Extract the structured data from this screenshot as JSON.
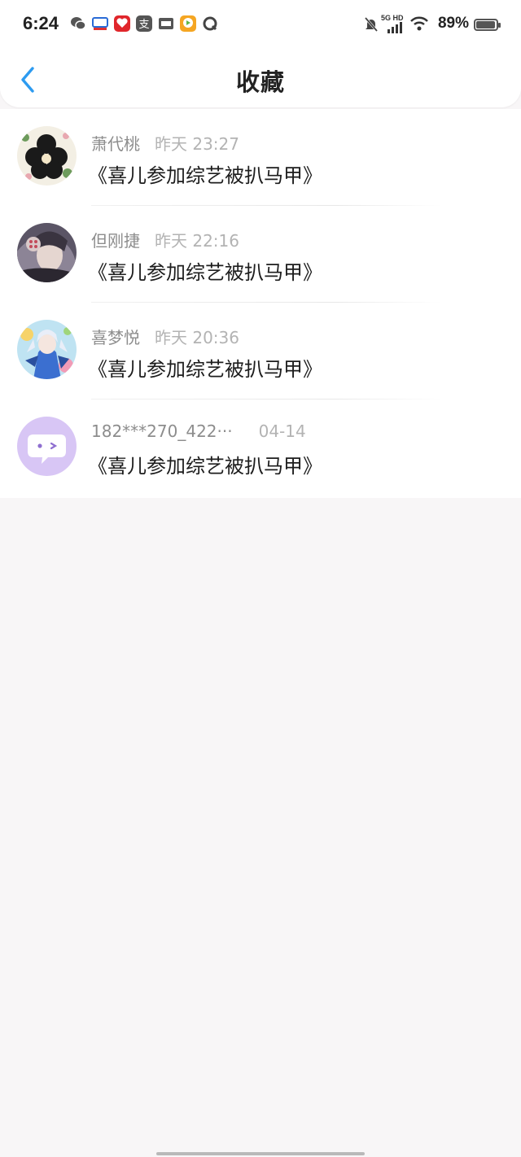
{
  "status_bar": {
    "time": "6:24",
    "network": "5G HD",
    "battery": "89%",
    "notification_icons": [
      "wechat-icon",
      "mail-icon",
      "app-red-icon",
      "alipay-icon",
      "toutiao-icon",
      "video-icon",
      "browser-icon"
    ],
    "system_icons": [
      "bell-off-icon",
      "signal-icon",
      "wifi-icon",
      "battery-icon"
    ]
  },
  "header": {
    "title": "收藏",
    "back_icon": "chevron-left-icon",
    "accent": "#2d9bf0"
  },
  "items": [
    {
      "name": "萧代桃",
      "date": "昨天 23:27",
      "content": "《喜儿参加综艺被扒马甲》",
      "avatar": "flower-avatar"
    },
    {
      "name": "但刚捷",
      "date": "昨天 22:16",
      "content": "《喜儿参加综艺被扒马甲》",
      "avatar": "anime-girl-avatar"
    },
    {
      "name": "喜梦悦",
      "date": "昨天 20:36",
      "content": "《喜儿参加综艺被扒马甲》",
      "avatar": "anime-character-avatar"
    },
    {
      "name": "182***270_422···",
      "date": "04-14",
      "content": "《喜儿参加综艺被扒马甲》",
      "avatar": "chat-bubble-avatar"
    }
  ]
}
